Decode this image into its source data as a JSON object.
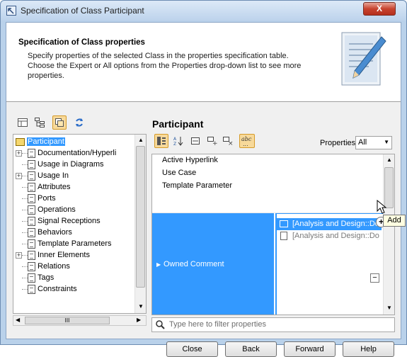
{
  "window": {
    "title": "Specification of Class Participant",
    "close_glyph": "X"
  },
  "header": {
    "title": "Specification of Class properties",
    "description": "Specify properties of the selected Class in the properties specification table. Choose the Expert or All options from the Properties drop-down list to see more properties."
  },
  "left_toolbar": {
    "icons": [
      "grid-view-icon",
      "tree-view-icon",
      "filter-toggle-icon",
      "refresh-icon"
    ]
  },
  "tree": {
    "items": [
      {
        "label": "Participant",
        "expand": "",
        "selected": true,
        "root": true
      },
      {
        "label": "Documentation/Hyperli",
        "expand": "+"
      },
      {
        "label": "Usage in Diagrams",
        "expand": ""
      },
      {
        "label": "Usage In",
        "expand": "+"
      },
      {
        "label": "Attributes",
        "expand": ""
      },
      {
        "label": "Ports",
        "expand": ""
      },
      {
        "label": "Operations",
        "expand": ""
      },
      {
        "label": "Signal Receptions",
        "expand": ""
      },
      {
        "label": "Behaviors",
        "expand": ""
      },
      {
        "label": "Template Parameters",
        "expand": ""
      },
      {
        "label": "Inner Elements",
        "expand": "+"
      },
      {
        "label": "Relations",
        "expand": ""
      },
      {
        "label": "Tags",
        "expand": ""
      },
      {
        "label": "Constraints",
        "expand": ""
      }
    ],
    "hscroll_grip": "III"
  },
  "panel_title": "Participant",
  "properties": {
    "label": "Properties:",
    "selected": "All"
  },
  "grid": {
    "rows": [
      "Active Hyperlink",
      "Use Case",
      "Template Parameter"
    ],
    "owned_comment_label": "Owned Comment",
    "comments": [
      "[Analysis and Design::Do",
      "[Analysis and Design::Do"
    ]
  },
  "filter": {
    "placeholder": "Type here to filter properties"
  },
  "tooltip": "Add",
  "buttons": {
    "close": "Close",
    "back": "Back",
    "forward": "Forward",
    "help": "Help"
  }
}
